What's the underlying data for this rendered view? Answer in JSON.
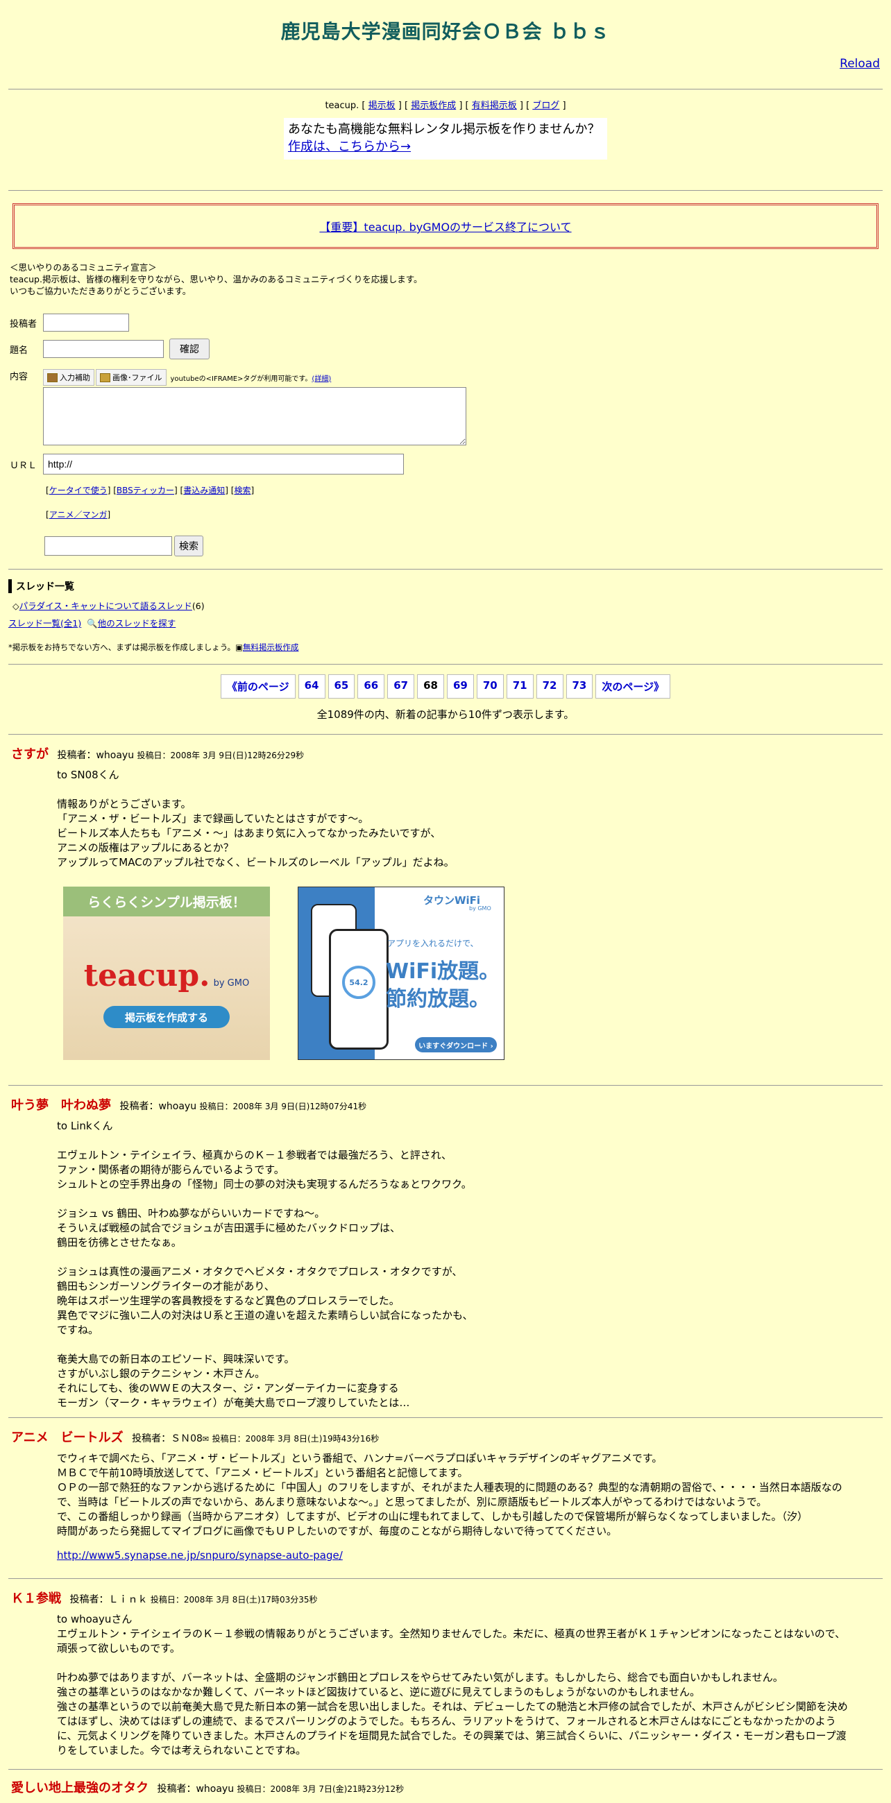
{
  "header": {
    "title": "鹿児島大学漫画同好会ＯＢ会 ｂｂｓ",
    "reload": "Reload"
  },
  "teacup_bar": {
    "brand": "teacup.",
    "links": [
      "掲示板",
      "掲示板作成",
      "有料掲示板",
      "ブログ"
    ]
  },
  "promo": {
    "line1": "あなたも高機能な無料レンタル掲示板を作りませんか？",
    "line2": "作成は、こちらから→"
  },
  "notice": {
    "text": "【重要】teacup. byGMOのサービス終了について"
  },
  "declaration": {
    "line1": "＜思いやりのあるコミュニティ宣言＞",
    "line2": "teacup.掲示板は、皆様の権利を守りながら、思いやり、温かみのあるコミュニティづくりを応援します。",
    "line3": "いつもご協力いただきありがとうございます。"
  },
  "form": {
    "author_label": "投稿者",
    "subject_label": "題名",
    "confirm_button": "確認",
    "content_label": "内容",
    "tool_input_help": "入力補助",
    "tool_image_file": "画像･ファイル",
    "youtube_note": "youtubeの<IFRAME>タグが利用可能です。",
    "detail_link": "(詳細)",
    "url_label": "ＵＲＬ",
    "url_value": "http://",
    "links": [
      "ケータイで使う",
      "BBSティッカー",
      "書込み通知",
      "検索"
    ],
    "category_link": "アニメ／マンガ",
    "search_button": "検索"
  },
  "threads": {
    "heading": "スレッド一覧",
    "item_label": "パラダイス・キャットについて語るスレッド",
    "item_count": "(6)",
    "all_link": "スレッド一覧(全1)",
    "find_link": "他のスレッドを探す",
    "note": "*掲示板をお持ちでない方へ、まずは掲示板を作成しましょう。",
    "create_link": "無料掲示板作成"
  },
  "pager": {
    "prev": "《前のページ",
    "pages": [
      "64",
      "65",
      "66",
      "67",
      "68",
      "69",
      "70",
      "71",
      "72",
      "73"
    ],
    "current": "68",
    "next": "次のページ》",
    "summary": "全1089件の内、新着の記事から10件ずつ表示します。"
  },
  "ads": {
    "ad1_title": "らくらくシンプル掲示板！",
    "ad1_logo": "teacup.",
    "ad1_gmo": "by GMO",
    "ad1_button": "掲示板を作成する",
    "ad2_brand": "タウンWiFi",
    "ad2_gmo": "by GMO",
    "ad2_text1": "アプリを入れるだけで、",
    "ad2_text2": "WiFi放題。",
    "ad2_text3": "節約放題。",
    "ad2_speed": "54.2",
    "ad2_button": "いますぐダウンロード ›"
  },
  "posts": [
    {
      "title": "さすが",
      "author_label": "投稿者：",
      "author": "whoayu",
      "date": "投稿日：2008年 3月 9日(日)12時26分29秒",
      "lines": [
        "to SN08くん",
        "",
        "情報ありがとうございます。",
        "「アニメ・ザ・ビートルズ」まで録画していたとはさすがです～。",
        "ビートルズ本人たちも「アニメ・～」はあまり気に入ってなかったみたいですが、",
        "アニメの版権はアップルにあるとか？",
        "アップルってMACのアップル社でなく、ビートルズのレーベル「アップル」だよね。"
      ]
    },
    {
      "title": "叶う夢　叶わぬ夢",
      "author_label": "投稿者：",
      "author": "whoayu",
      "date": "投稿日：2008年 3月 9日(日)12時07分41秒",
      "lines": [
        "to Linkくん",
        "",
        "エヴェルトン・テイシェイラ、極真からのＫ－１参戦者では最強だろう、と評され、",
        "ファン・関係者の期待が膨らんでいるようです。",
        "シュルトとの空手界出身の「怪物」同士の夢の対決も実現するんだろうなぁとワクワク。",
        "",
        "ジョシュ vs 鶴田、叶わぬ夢ながらいいカードですね～。",
        "そういえば戦極の試合でジョシュが吉田選手に極めたバックドロップは、",
        "鶴田を彷彿とさせたなぁ。",
        "",
        "ジョシュは真性の漫画アニメ・オタクでヘビメタ・オタクでプロレス・オタクですが、",
        "鶴田もシンガーソングライターの才能があり、",
        "晩年はスポーツ生理学の客員教授をするなど異色のプロレスラーでした。",
        "異色でマジに強い二人の対決はＵ系と王道の違いを超えた素晴らしい試合になったかも、",
        "ですね。",
        "",
        "奄美大島での新日本のエピソード、興味深いです。",
        "さすがいぶし銀のテクニシャン・木戸さん。",
        "それにしても、後のＷＷＥの大スター、ジ・アンダーテイカーに変身する",
        "モーガン（マーク・キャラウェイ）が奄美大島でロープ渡りしていたとは…"
      ]
    },
    {
      "title": "アニメ　ビートルズ",
      "author_label": "投稿者：",
      "author": "ＳＮ08",
      "date": "投稿日：2008年 3月 8日(土)19時43分16秒",
      "lines": [
        "でウィキで調べたら、「アニメ・ザ・ビートルズ」という番組で、ハンナ=バーベラプロぽいキャラデザインのギャグアニメです。",
        "ＭＢＣで午前10時頃放送してて、「アニメ・ビートルズ」という番組名と記憶してます。",
        "ＯＰの一部で熱狂的なファンから逃げるために「中国人」のフリをしますが、それがまた人種表現的に問題のある？典型的な清朝期の習俗で、・・・・当然日本語版なので、当時は「ビートルズの声でないから、あんまり意味ないよな～。」と思ってましたが、別に原語版もビートルズ本人がやってるわけではないようで。",
        "で、この番組しっかり録画（当時からアニオタ）してますが、ビデオの山に埋もれてまして、しかも引越したので保管場所が解らなくなってしまいました。（汐）",
        "時間があったら発掘してマイブログに画像でもＵＰしたいのですが、毎度のことながら期待しないで待っててください。"
      ],
      "link": "http://www5.synapse.ne.jp/snpuro/synapse-auto-page/"
    },
    {
      "title": "Ｋ１参戦",
      "author_label": "投稿者：",
      "author": "Ｌｉｎｋ",
      "date": "投稿日：2008年 3月 8日(土)17時03分35秒",
      "lines": [
        "to whoayuさん",
        "エヴェルトン・テイシェイラのＫ－１参戦の情報ありがとうございます。全然知りませんでした。未だに、極真の世界王者がＫ１チャンピオンになったことはないので、頑張って欲しいものです。",
        "",
        "叶わぬ夢ではありますが、バーネットは、全盛期のジャンボ鶴田とプロレスをやらせてみたい気がします。もしかしたら、総合でも面白いかもしれません。",
        "強さの基準というのはなかなか難しくて、バーネットほど図抜けていると、逆に遊びに見えてしまうのもしょうがないのかもしれません。",
        "強さの基準というので以前奄美大島で見た新日本の第一試合を思い出しました。それは、デビューしたての馳浩と木戸修の試合でしたが、木戸さんがビシビシ関節を決めてはほずし、決めてはほずしの連続で、まるでスパーリングのようでした。もちろん、ラリアットをうけて、フォールされると木戸さんはなにごともなかったかのように、元気よくリングを降りていきました。木戸さんのプライドを垣間見た試合でした。その興業では、第三試合くらいに、パニッシャー・ダイス・モーガン君もロープ渡りをしていました。今では考えられないことですね。"
      ]
    },
    {
      "title": "愛しい地上最強のオタク",
      "author_label": "投稿者：",
      "author": "whoayu",
      "date": "投稿日：2008年 3月 7日(金)21時23分12秒",
      "lines": []
    }
  ]
}
